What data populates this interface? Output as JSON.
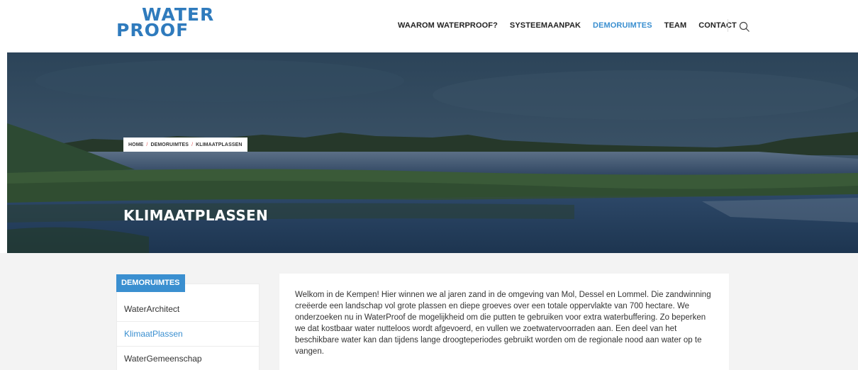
{
  "logo": {
    "line1": "WATER",
    "line2": "PROOF"
  },
  "nav": {
    "items": [
      {
        "label": "WAAROM WATERPROOF?",
        "active": false
      },
      {
        "label": "SYSTEEMAANPAK",
        "active": false
      },
      {
        "label": "DEMORUIMTES",
        "active": true
      },
      {
        "label": "TEAM",
        "active": false
      },
      {
        "label": "CONTACT",
        "active": false
      }
    ],
    "search_icon": "search-icon"
  },
  "breadcrumb": {
    "home": "HOME",
    "separator": "/",
    "section": "DEMORUIMTES",
    "current": "KLIMAATPLASSEN"
  },
  "hero": {
    "title": "KLIMAATPLASSEN"
  },
  "sidebar": {
    "heading": "DEMORUIMTES",
    "items": [
      {
        "label": "WaterArchitect",
        "active": false
      },
      {
        "label": "KlimaatPlassen",
        "active": true
      },
      {
        "label": "WaterGemeenschap",
        "active": false
      }
    ]
  },
  "content": {
    "paragraph": "Welkom in de Kempen! Hier winnen we al jaren zand in de omgeving van Mol, Dessel en Lommel. Die zandwinning creëerde een landschap vol grote plassen en diepe groeves over een totale oppervlakte van 700 hectare. We onderzoeken nu in WaterProof de mogelijkheid om die putten te gebruiken voor extra waterbuffering. Zo beperken we dat kostbaar water nutteloos wordt afgevoerd, en vullen we zoetwatervoorraden aan. Een deel van het beschikbare water kan dan tijdens lange droogteperiodes gebruikt worden om de regionale nood aan water op te vangen."
  },
  "colors": {
    "accent": "#3a8fd0",
    "breadcrumb_sep": "#e05555",
    "logo": "#2f7bbd"
  }
}
